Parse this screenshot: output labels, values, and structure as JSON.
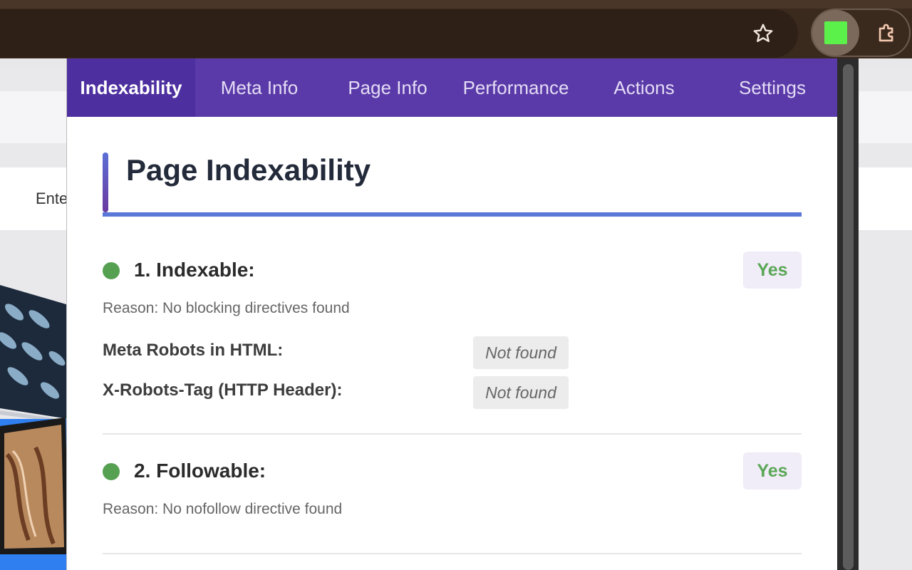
{
  "browser": {
    "star_icon": "star-icon",
    "extension_icon_color": "#5cf04a",
    "puzzle_icon": "puzzle-icon"
  },
  "background_page": {
    "partial_text": "Ente"
  },
  "popup": {
    "tabs": [
      {
        "label": "Indexability",
        "active": true
      },
      {
        "label": "Meta Info",
        "active": false
      },
      {
        "label": "Page Info",
        "active": false
      },
      {
        "label": "Performance",
        "active": false
      },
      {
        "label": "Actions",
        "active": false
      },
      {
        "label": "Settings",
        "active": false
      }
    ],
    "title": "Page Indexability",
    "checks": [
      {
        "label": "1. Indexable:",
        "status": "Yes",
        "reason": "Reason: No blocking directives found",
        "details": [
          {
            "key": "Meta Robots in HTML:",
            "value": "Not found"
          },
          {
            "key": "X-Robots-Tag (HTTP Header):",
            "value": "Not found"
          }
        ]
      },
      {
        "label": "2. Followable:",
        "status": "Yes",
        "reason": "Reason: No nofollow directive found"
      }
    ]
  },
  "colors": {
    "tabbar": "#5a3aa8",
    "active_tab": "#4d2fa0",
    "status_ok": "#56a052",
    "accent": "#5a78d8"
  }
}
